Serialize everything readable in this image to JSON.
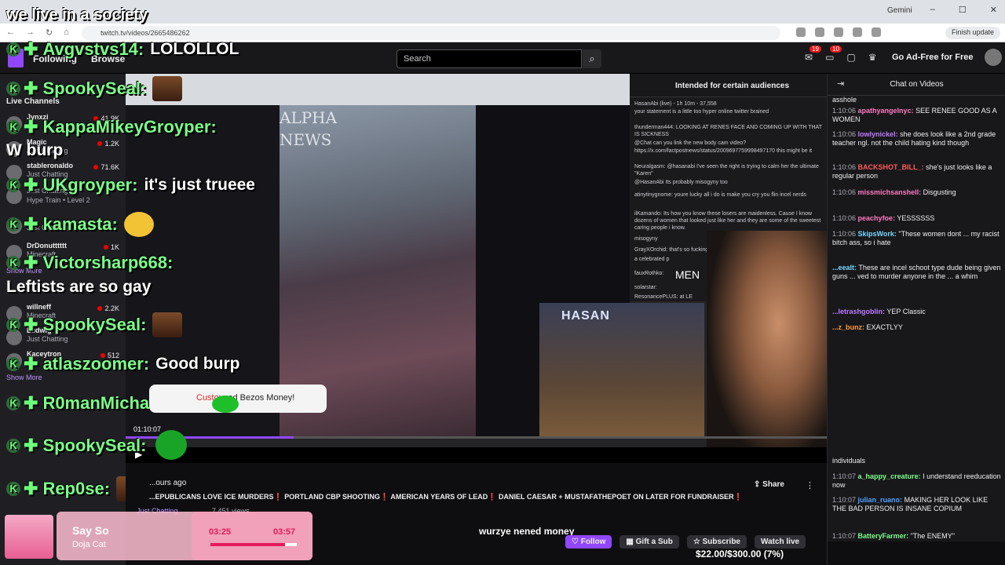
{
  "browser": {
    "gemini": "Gemini",
    "url": "twitch.tv/videos/2665486262",
    "finish_update": "Finish update"
  },
  "nav": {
    "following": "Following",
    "browse": "Browse",
    "search_placeholder": "Search",
    "badge_a": "19",
    "badge_b": "10",
    "ad_free": "Go Ad-Free for Free"
  },
  "sidebar": {
    "live_channels": "Live Channels",
    "show_more": "Show More",
    "channels": [
      {
        "name": "Jynxzi",
        "category": "",
        "viewers": "41.9K"
      },
      {
        "name": "Magic",
        "category": "Just Chatting",
        "viewers": "1.2K"
      },
      {
        "name": "stableronaldo",
        "category": "Just Chatting",
        "viewers": "71.6K"
      },
      {
        "name": "",
        "category": "Just Chatting",
        "viewers": ""
      },
      {
        "name": "",
        "category": "Just Chatting",
        "viewers": ""
      },
      {
        "name": "DrDonutttttt",
        "category": "Minecraft",
        "viewers": "1K"
      },
      {
        "name": "willneff",
        "category": "Minecraft",
        "viewers": "2.2K"
      },
      {
        "name": "Ludwig",
        "category": "Just Chatting",
        "viewers": ""
      },
      {
        "name": "Kaceytron",
        "category": "",
        "viewers": "512"
      }
    ],
    "hype_train": "Hype Train • Level 2"
  },
  "overlay": {
    "title": "we live in a society",
    "lines": [
      {
        "name": "Avgvstvs14:",
        "msg": "LOLOLLOL",
        "emote": false
      },
      {
        "name": "SpookySeal:",
        "msg": "",
        "emote": true
      },
      {
        "name": "KappaMikeyGroyper:",
        "msg": "",
        "emote": false
      },
      {
        "name": "UKgroyper:",
        "msg": "it's just trueee",
        "emote": false
      },
      {
        "name": "kamasta:",
        "msg": "",
        "emote": true
      },
      {
        "name": "Victorsharp668:",
        "msg": "",
        "emote": false
      },
      {
        "name": "SpookySeal:",
        "msg": "",
        "emote": true
      },
      {
        "name": "atlaszoomer:",
        "msg": "Good burp",
        "emote": false
      },
      {
        "name": "R0manMichael5AF:",
        "msg": "",
        "emote": false
      },
      {
        "name": "SpookySeal:",
        "msg": "",
        "emote": false
      },
      {
        "name": "Rep0se:",
        "msg": "",
        "emote": true
      }
    ],
    "w_burp": "W burp",
    "leftists": "Leftists are so gay"
  },
  "player": {
    "alpha_news": "ALPHA\nNEWS",
    "panel_audience": "Intended for certain audiences",
    "panel_lines": [
      "HasanAbi (live) - 1h 10m - 37,558",
      "your statement is a little too hyper online twitter brained",
      "thunderman444: LOOKING AT RENES FACE AND COMING UP WITH THAT IS SICKNESS",
      "@Chat can you link the new body cam video?",
      "https://x.com/factpostnews/status/2009697759998497170 this might be it",
      "Neuralgasm: @hasanabi I've seen the right is trying to calm her the ultimate \"Karen\"",
      "@HasanAbi Its probably misogyny too",
      "atinytinygnome: youre lucky all i do is make you cry you flin incel nerds",
      "ilKamando: Its how you know these losers are maidenless. Cause I know dozens of women that looked just like her and they are some of the sweetest caring people i know.",
      "misogyny",
      "GrayXOrchid: that's so fucking awful",
      "a celebrated p",
      "fauxRothko:",
      "solarstar:",
      "ResonancePLUS: at LE"
    ],
    "men": "MEN",
    "hasan": "HASAN",
    "time": "01:10:07",
    "progress": 0.24,
    "bezos_prefix": "Custo",
    "bezos_text": "used Bezos Money!"
  },
  "chat": {
    "title": "Chat on Videos",
    "lines": [
      {
        "t": "",
        "user": "",
        "color": "#ffffff",
        "msg": "asshole"
      },
      {
        "t": "1:10:06",
        "user": "apathyangelnyc:",
        "color": "#ff7ac3",
        "msg": "SEE RENEE GOOD AS A WOMEN"
      },
      {
        "t": "1:10:06",
        "user": "lowlynickel:",
        "color": "#c07bff",
        "msg": "she does look like a 2nd grade teacher ngl. not the child hating kind though"
      },
      {
        "t": "1:10:06",
        "user": "BACKSHOT_BILL_:",
        "color": "#ff5a5a",
        "msg": "she's just looks like a regular person"
      },
      {
        "t": "1:10:06",
        "user": "missmichsanshell:",
        "color": "#ff7ac3",
        "msg": "Disgusting"
      },
      {
        "t": "1:10:06",
        "user": "peachyfoe:",
        "color": "#ff7ac3",
        "msg": "YESSSSSS"
      },
      {
        "t": "1:10:06",
        "user": "SkipsWork:",
        "color": "#7ad6ff",
        "msg": "\"These women dont ... my racist bitch ass, so i hate"
      },
      {
        "t": "",
        "user": "...eealt:",
        "color": "#7ad6ff",
        "msg": "These are incel schoot type dude being given guns ... ved to murder anyone in the ... a whim"
      },
      {
        "t": "",
        "user": "...letrashgoblin:",
        "color": "#c07bff",
        "msg": "YEP Classic"
      },
      {
        "t": "",
        "user": "...z_bunz:",
        "color": "#ff9a3c",
        "msg": "EXACTLYY"
      },
      {
        "t": "",
        "user": "",
        "color": "#ffffff",
        "msg": "individuals"
      },
      {
        "t": "1:10:07",
        "user": "a_happy_creature:",
        "color": "#7dff8a",
        "msg": "I understand reeducation now"
      },
      {
        "t": "1:10:07",
        "user": "julian_ruano:",
        "color": "#4fa3ff",
        "msg": "MAKING HER LOOK LIKE THE BAD PERSON IS INSANE COPIUM"
      },
      {
        "t": "1:10:07",
        "user": "BatteryFarmer:",
        "color": "#7dff8a",
        "msg": "\"The ENEMY\""
      }
    ],
    "goal": "$22.00/$300.00 (7%)"
  },
  "info": {
    "ago": "...ours ago",
    "title": "...EPUBLICANS LOVE ICE MURDERS❗ PORTLAND CBP SHOOTING❗ AMERICAN YEARS OF LEAD❗ DANIEL CAESAR + MUSTAFATHEPOET ON LATER FOR FUNDRAISER❗",
    "category": "Just Chatting",
    "views": "7,451 views",
    "share": "Share",
    "wurzye": "wurzye nened money",
    "follow": "Follow",
    "gift": "Gift a Sub",
    "subscribe": "Subscribe",
    "watch_live": "Watch live"
  },
  "now_playing": {
    "title": "Say So",
    "artist": "Doja Cat",
    "elapsed": "03:25",
    "total": "03:57",
    "progress": 0.86
  }
}
